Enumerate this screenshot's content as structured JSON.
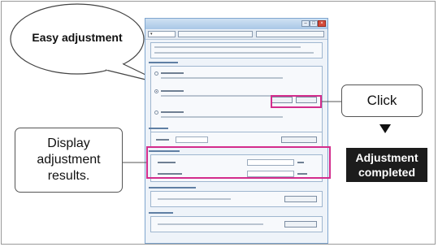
{
  "annotations": {
    "easy_adjustment": "Easy adjustment",
    "click": "Click",
    "display_results": "Display adjustment results.",
    "adjustment_completed": "Adjustment completed"
  },
  "colors": {
    "highlight": "#d32c8c",
    "completed_bg": "#1c1c1c",
    "window_titlebar": "#a9c7e6"
  },
  "icons": {
    "close": "close-icon",
    "down_arrow": "down-arrow-icon"
  }
}
